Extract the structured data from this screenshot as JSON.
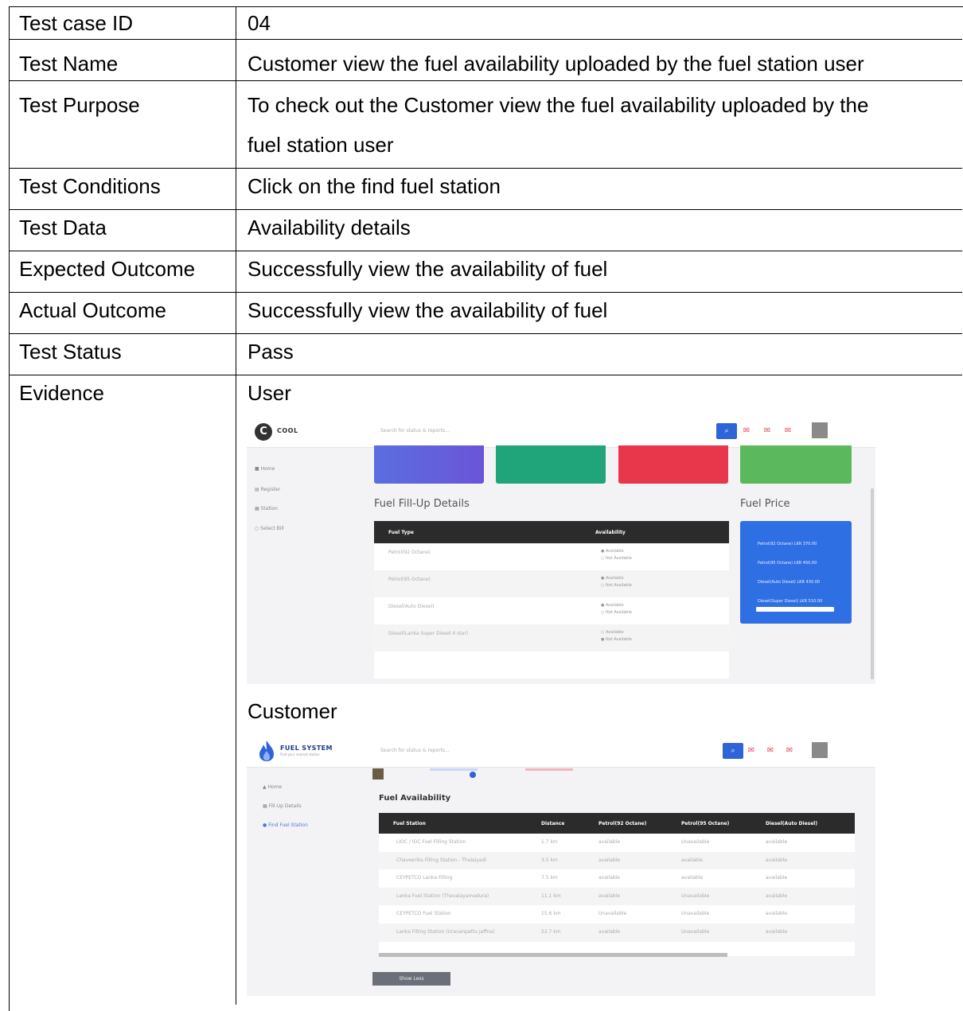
{
  "rows": [
    {
      "label": "Test case ID",
      "value": "04"
    },
    {
      "label": "Test Name",
      "value": "Customer view the fuel availability uploaded by the fuel station user"
    },
    {
      "label": "Test Purpose",
      "value_line1": "To check out the Customer view the fuel availability uploaded by the",
      "value_line2": "fuel station user"
    },
    {
      "label": "Test Conditions",
      "value": "Click on the find fuel station"
    },
    {
      "label": "Test Data",
      "value": "Availability details"
    },
    {
      "label": "Expected Outcome",
      "value": "Successfully view the availability of fuel"
    },
    {
      "label": "Actual Outcome",
      "value": "Successfully view the availability of fuel"
    },
    {
      "label": "Test Status",
      "value": "Pass"
    },
    {
      "label": "Evidence",
      "value": "User",
      "value2": "Customer"
    }
  ],
  "user_screen": {
    "logo": "COOL",
    "logo_initial": "C",
    "search_placeholder": "Search for status & reports...",
    "sidebar": [
      "Home",
      "Register",
      "Station",
      "Select Bill"
    ],
    "fill_up_title": "Fuel Fill-Up Details",
    "fuel_price_title": "Fuel Price",
    "table_headers": [
      "Fuel Type",
      "Availability"
    ],
    "fuel_types": [
      "Petrol(92 Octane)",
      "Petrol(95 Octane)",
      "Diesel(Auto Diesel)",
      "Diesel(Lanka Super Diesel 4 star)"
    ],
    "option_available": "Available",
    "option_not_available": "Not Available",
    "prices": [
      "Petrol(92 Octane)  LKR 370.00",
      "Petrol(95 Octane)  LKR 450.00",
      "Diesel(Auto Diesel)  LKR 430.00",
      "Diesel(Super Diesel)  LKR 510.00"
    ],
    "card_colors": [
      "#6a55d8",
      "#20a57a",
      "#e8364a",
      "#5cb85c"
    ]
  },
  "customer_screen": {
    "logo": "FUEL SYSTEM",
    "logo_sub": "Find your nearest station",
    "search_placeholder": "Search for status & reports...",
    "sidebar": [
      "Home",
      "Fill-Up Details",
      "Find Fuel Station"
    ],
    "title": "Fuel Availability",
    "headers": [
      "Fuel Station",
      "Distance",
      "Petrol(92 Octane)",
      "Petrol(95 Octane)",
      "Diesel(Auto Diesel)"
    ],
    "rows": [
      [
        "LIOC / IOC Fuel Filling Station",
        "1.7 km",
        "available",
        "Unavailable",
        "available"
      ],
      [
        "Chaveerika Filling Station - Thalaiyadi",
        "3.5 km",
        "available",
        "available",
        "available"
      ],
      [
        "CEYPETCO Lanka Filling",
        "7.5 km",
        "available",
        "available",
        "available"
      ],
      [
        "Lanka Fuel Station (Thavalayamadura)",
        "11.1 km",
        "available",
        "Unavailable",
        "available"
      ],
      [
        "CEYPETCO Fuel Station",
        "15.6 km",
        "Unavailable",
        "Unavailable",
        "available"
      ],
      [
        "Lanka Filling Station (Uravanpattu Jaffna)",
        "22.7 km",
        "available",
        "Unavailable",
        "available"
      ]
    ],
    "show_less": "Show Less"
  }
}
